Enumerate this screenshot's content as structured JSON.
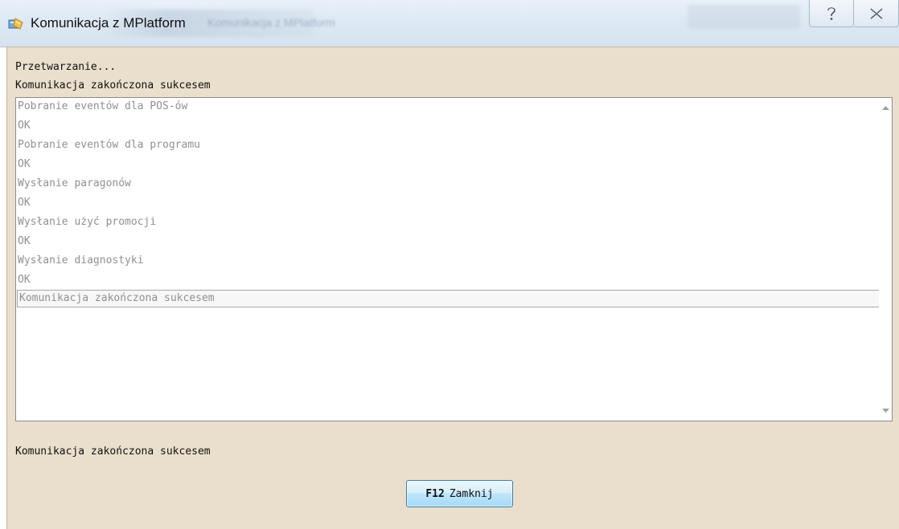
{
  "window": {
    "title": "Komunikacja z MPlatform",
    "ghost_title": "Komunikacja z MPlatform"
  },
  "status": {
    "line1": "Przetwarzanie...",
    "line2": "Komunikacja zakończona sukcesem"
  },
  "log": {
    "items": [
      "Pobranie eventów dla POS-ów",
      "OK",
      "Pobranie eventów dla programu",
      "OK",
      "Wysłanie paragonów",
      "OK",
      "Wysłanie użyć promocji",
      "OK",
      "Wysłanie diagnostyki",
      "OK",
      "Komunikacja zakończona sukcesem"
    ],
    "selected_index": 10
  },
  "footer": {
    "status": "Komunikacja zakończona sukcesem"
  },
  "buttons": {
    "close_key": "F12",
    "close_label": "Zamknij"
  },
  "colors": {
    "client_bg": "#e9dfcc",
    "log_text": "#909090",
    "button_border": "#3c7fb1"
  },
  "icons": {
    "app": "app-package-icon",
    "help": "help-icon",
    "close": "close-icon",
    "scroll_up": "scroll-up-icon",
    "scroll_down": "scroll-down-icon"
  }
}
